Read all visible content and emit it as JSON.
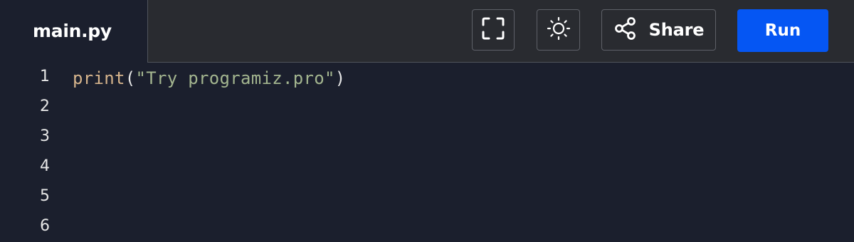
{
  "file_tab": {
    "label": "main.py"
  },
  "toolbar": {
    "fullscreen_icon": "fullscreen-icon",
    "theme_icon": "sun-icon",
    "share_icon": "share-icon",
    "share_label": "Share",
    "run_label": "Run"
  },
  "editor": {
    "line_numbers": [
      "1",
      "2",
      "3",
      "4",
      "5",
      "6"
    ],
    "code": {
      "line1": {
        "fn": "print",
        "open_paren": "(",
        "string": "\"Try programiz.pro\"",
        "close_paren": ")"
      }
    }
  },
  "colors": {
    "background": "#1b1f2d",
    "toolbar_bg": "#292b30",
    "run_button": "#0556f3",
    "function": "#d6b48c",
    "string": "#a3b58f"
  }
}
